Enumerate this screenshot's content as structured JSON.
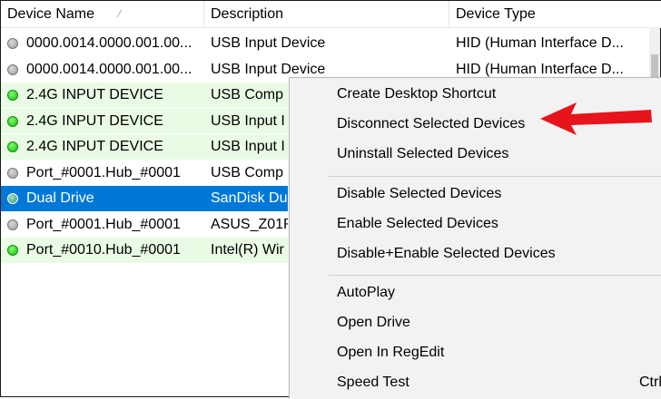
{
  "columns": {
    "name": "Device Name",
    "description": "Description",
    "type": "Device Type"
  },
  "rows": [
    {
      "name": "0000.0014.0000.001.00...",
      "description": "USB Input Device",
      "type": "HID (Human Interface D...",
      "status": "gray"
    },
    {
      "name": "0000.0014.0000.001.00...",
      "description": "USB Input Device",
      "type": "HID (Human Interface D...",
      "status": "gray"
    },
    {
      "name": "2.4G INPUT DEVICE",
      "description": "USB Comp",
      "type": "",
      "status": "green"
    },
    {
      "name": "2.4G INPUT DEVICE",
      "description": "USB Input I",
      "type": "",
      "status": "green"
    },
    {
      "name": "2.4G INPUT DEVICE",
      "description": "USB Input I",
      "type": "",
      "status": "green"
    },
    {
      "name": "Port_#0001.Hub_#0001",
      "description": "USB Comp",
      "type": "",
      "status": "gray"
    },
    {
      "name": "Dual Drive",
      "description": "SanDisk Du",
      "type": "",
      "status": "teal",
      "selected": true
    },
    {
      "name": "Port_#0001.Hub_#0001",
      "description": "ASUS_Z01R",
      "type": "",
      "status": "gray"
    },
    {
      "name": "Port_#0010.Hub_#0001",
      "description": "Intel(R) Wir",
      "type": "",
      "status": "green"
    }
  ],
  "context_menu": {
    "items": [
      {
        "label": "Create Desktop Shortcut"
      },
      {
        "label": "Disconnect Selected Devices"
      },
      {
        "label": "Uninstall Selected Devices"
      },
      {
        "label": "Disable Selected Devices"
      },
      {
        "label": "Enable Selected Devices"
      },
      {
        "label": "Disable+Enable Selected Devices"
      },
      {
        "label": "AutoPlay"
      },
      {
        "label": "Open Drive"
      },
      {
        "label": "Open In RegEdit"
      },
      {
        "label": "Speed Test",
        "shortcut": "Ctrl"
      }
    ]
  },
  "colors": {
    "selection": "#0078d7",
    "connected_row": "#e9fbe5",
    "annotation_arrow": "#e8141c"
  }
}
